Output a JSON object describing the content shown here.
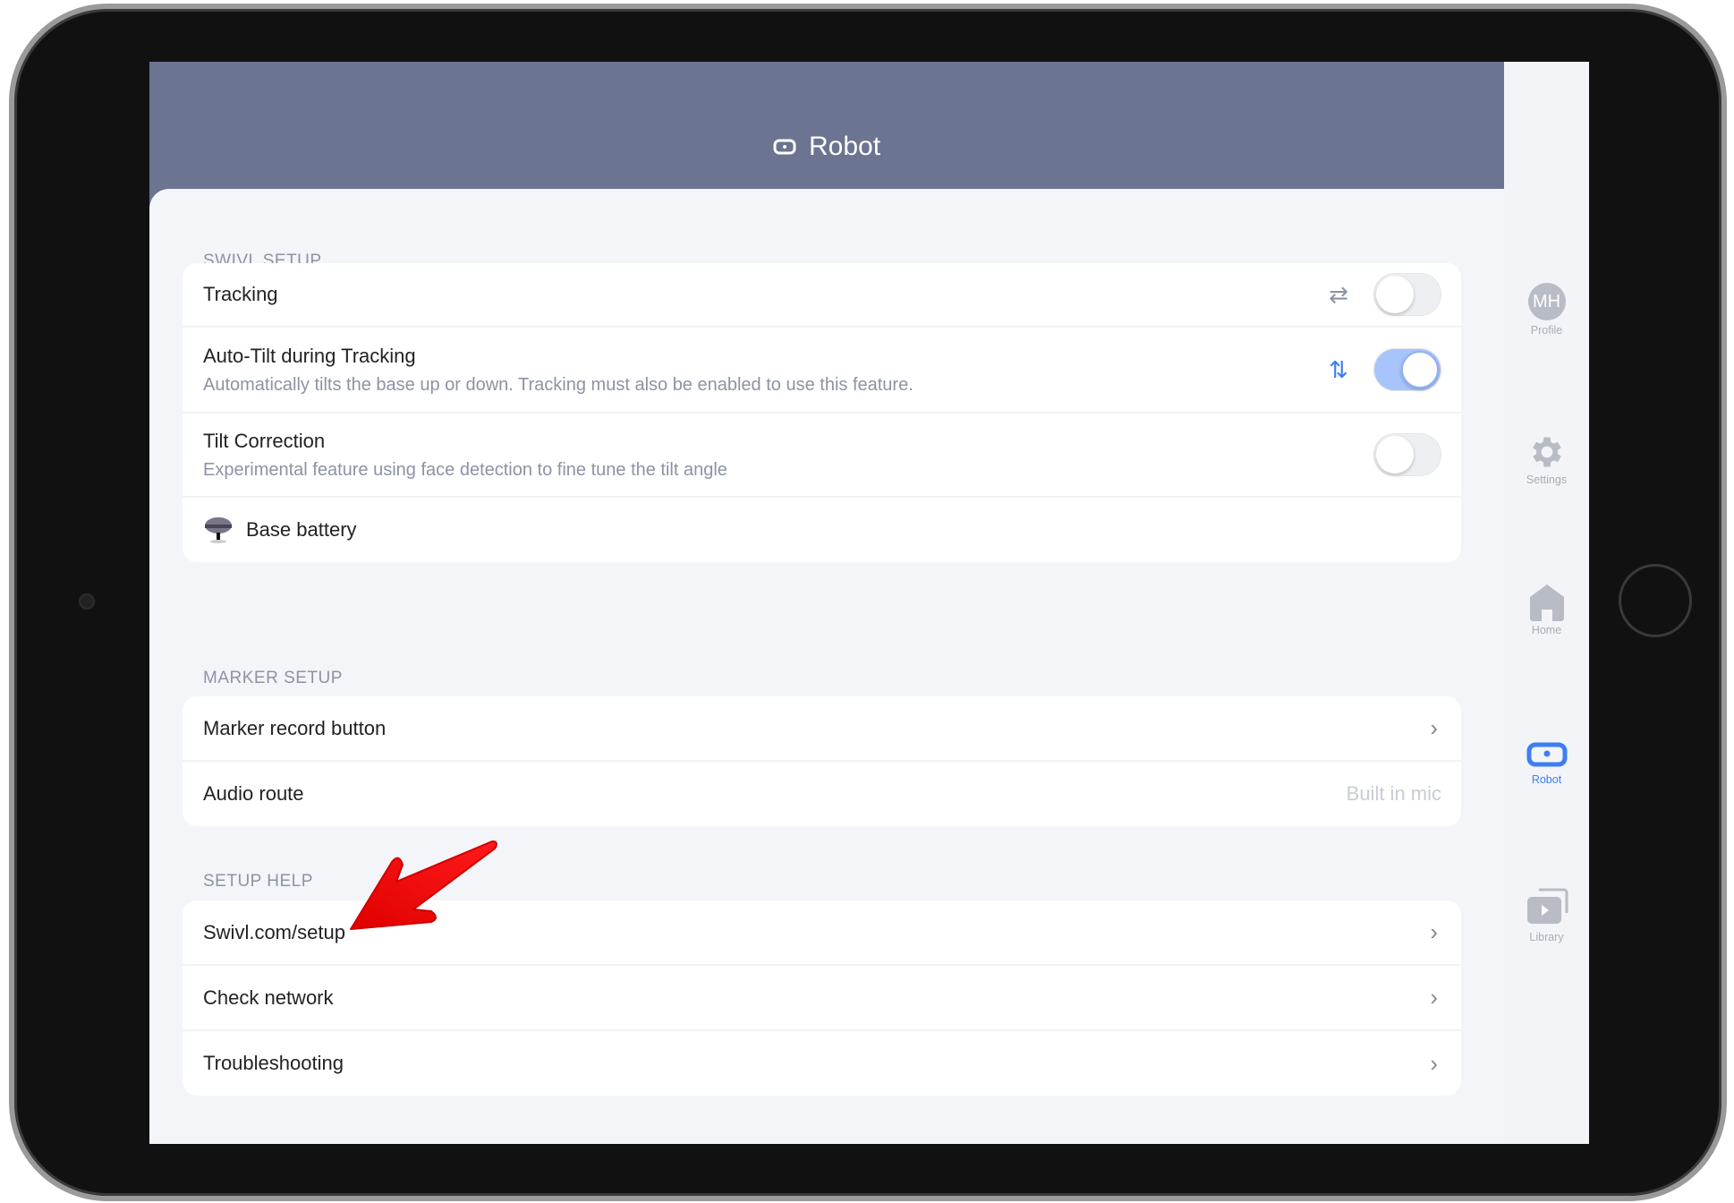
{
  "header": {
    "title": "Robot",
    "icon": "robot-icon"
  },
  "sections": [
    {
      "title": "SWIVL SETUP",
      "rows": [
        {
          "label": "Tracking",
          "icon": "swap-arrows-icon",
          "toggle": false
        },
        {
          "label": "Auto-Tilt during Tracking",
          "subtitle": "Automatically tilts the base up or down. Tracking must also be enabled to use this feature.",
          "icon": "up-down-arrows-icon",
          "toggle": true
        },
        {
          "label": "Tilt Correction",
          "subtitle": "Experimental feature using face detection to fine tune the tilt angle",
          "toggle": false
        },
        {
          "label": "Base battery",
          "icon": "base-icon"
        }
      ]
    },
    {
      "title": "MARKER SETUP",
      "rows": [
        {
          "label": "Marker record button"
        },
        {
          "label": "Audio route",
          "value": "Built in mic"
        }
      ]
    },
    {
      "title": "SETUP HELP",
      "rows": [
        {
          "label": "Swivl.com/setup"
        },
        {
          "label": "Check network"
        },
        {
          "label": "Troubleshooting"
        }
      ]
    }
  ],
  "sidebar": {
    "items": [
      {
        "label": "Profile",
        "avatar": "MH"
      },
      {
        "label": "Settings",
        "icon": "gear-icon"
      },
      {
        "label": "Home",
        "icon": "home-icon"
      },
      {
        "label": "Robot",
        "icon": "robot-icon",
        "active": true
      },
      {
        "label": "Library",
        "icon": "library-icon"
      }
    ]
  },
  "colors": {
    "header": "#6b7490",
    "accent": "#3d7ff2",
    "toggle_on": "#a8c5fb",
    "annotation_arrow": "#ff0000"
  }
}
